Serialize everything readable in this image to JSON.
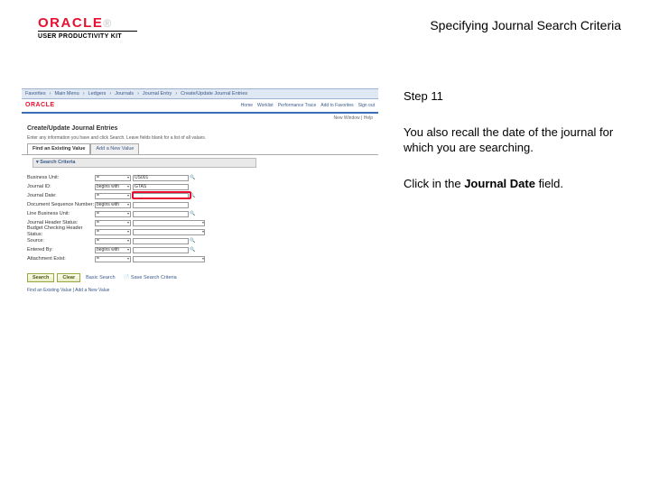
{
  "header": {
    "logo_text": "ORACLE",
    "logo_sub": "®",
    "kit_label": "USER PRODUCTIVITY KIT",
    "title": "Specifying Journal Search Criteria"
  },
  "right": {
    "step": "Step 11",
    "para1": "You also recall the date of the journal for which you are searching.",
    "click_prefix": "Click in the ",
    "click_bold": "Journal Date",
    "click_suffix": " field."
  },
  "app": {
    "breadcrumbs": [
      "Favorites",
      "Main Menu",
      "Ledgers",
      "Journals",
      "Journal Entry",
      "Create/Update Journal Entries"
    ],
    "logo": "ORACLE",
    "toplinks": [
      "Home",
      "Worklist",
      "Performance Trace",
      "Add to Favorites",
      "Sign out"
    ],
    "status": "New Window  |  Help",
    "page_title": "Create/Update Journal Entries",
    "page_desc": "Enter any information you have and click Search. Leave fields blank for a list of all values.",
    "tabs": {
      "t0": "Find an Existing Value",
      "t1": "Add a New Value"
    },
    "section_header": "▾ Search Criteria",
    "rows": [
      {
        "label": "Business Unit:",
        "op": "=",
        "val": "US001",
        "lookup": true
      },
      {
        "label": "Journal ID:",
        "op": "begins with",
        "val": "GTAS",
        "lookup": false
      },
      {
        "label": "Journal Date:",
        "op": "=",
        "val": "",
        "lookup": true,
        "highlight": true
      },
      {
        "label": "Document Sequence Number:",
        "op": "begins with",
        "val": "",
        "lookup": false
      },
      {
        "label": "Line Business Unit:",
        "op": "=",
        "val": "",
        "lookup": true
      },
      {
        "label": "Journal Header Status:",
        "op": "=",
        "val": "",
        "lookup": false,
        "dropdown": true
      },
      {
        "label": "Budget Checking Header Status:",
        "op": "=",
        "val": "",
        "lookup": false,
        "dropdown": true
      },
      {
        "label": "Source:",
        "op": "=",
        "val": "",
        "lookup": true
      },
      {
        "label": "Entered By:",
        "op": "begins with",
        "val": "",
        "lookup": true
      },
      {
        "label": "Attachment Exist:",
        "op": "=",
        "val": "",
        "lookup": false,
        "dropdown": true
      }
    ],
    "buttons": {
      "search": "Search",
      "clear": "Clear",
      "basic": "Basic Search",
      "save": "Save Search Criteria"
    },
    "footer": "Find an Existing Value  |  Add a New Value"
  }
}
